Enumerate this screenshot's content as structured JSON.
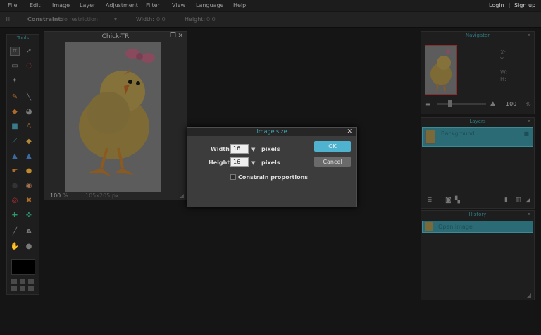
{
  "menu": [
    "File",
    "Edit",
    "Image",
    "Layer",
    "Adjustment",
    "Filter",
    "View",
    "Language",
    "Help"
  ],
  "auth": {
    "login": "Login",
    "signup": "Sign up"
  },
  "toolbar": {
    "constraint_label": "Constraint:",
    "constraint_value": "No restriction",
    "width_label": "Width:",
    "width_value": "0.0",
    "height_label": "Height:",
    "height_value": "0.0"
  },
  "tools_panel": {
    "title": "Tools"
  },
  "document": {
    "title": "Chick-TR",
    "zoom": "100",
    "zoom_unit": "%",
    "size": "105x205 px"
  },
  "navigator": {
    "title": "Navigator",
    "x_label": "X:",
    "y_label": "Y:",
    "w_label": "W:",
    "h_label": "H:",
    "zoom_value": "100",
    "zoom_unit": "%"
  },
  "layers": {
    "title": "Layers",
    "items": [
      {
        "name": "Background"
      }
    ]
  },
  "history": {
    "title": "History",
    "items": [
      {
        "name": "Open image"
      }
    ]
  },
  "dialog": {
    "title": "Image size",
    "width_label": "Width:",
    "width_value": "16",
    "width_unit": "pixels",
    "height_label": "Height:",
    "height_value": "16",
    "height_unit": "pixels",
    "constrain_label": "Constrain proportions",
    "constrain_checked": false,
    "ok_label": "OK",
    "cancel_label": "Cancel"
  },
  "colors": {
    "accent": "#3fa9b4",
    "ok_button": "#4fb3cf",
    "layer_highlight": "#2a6b75"
  }
}
